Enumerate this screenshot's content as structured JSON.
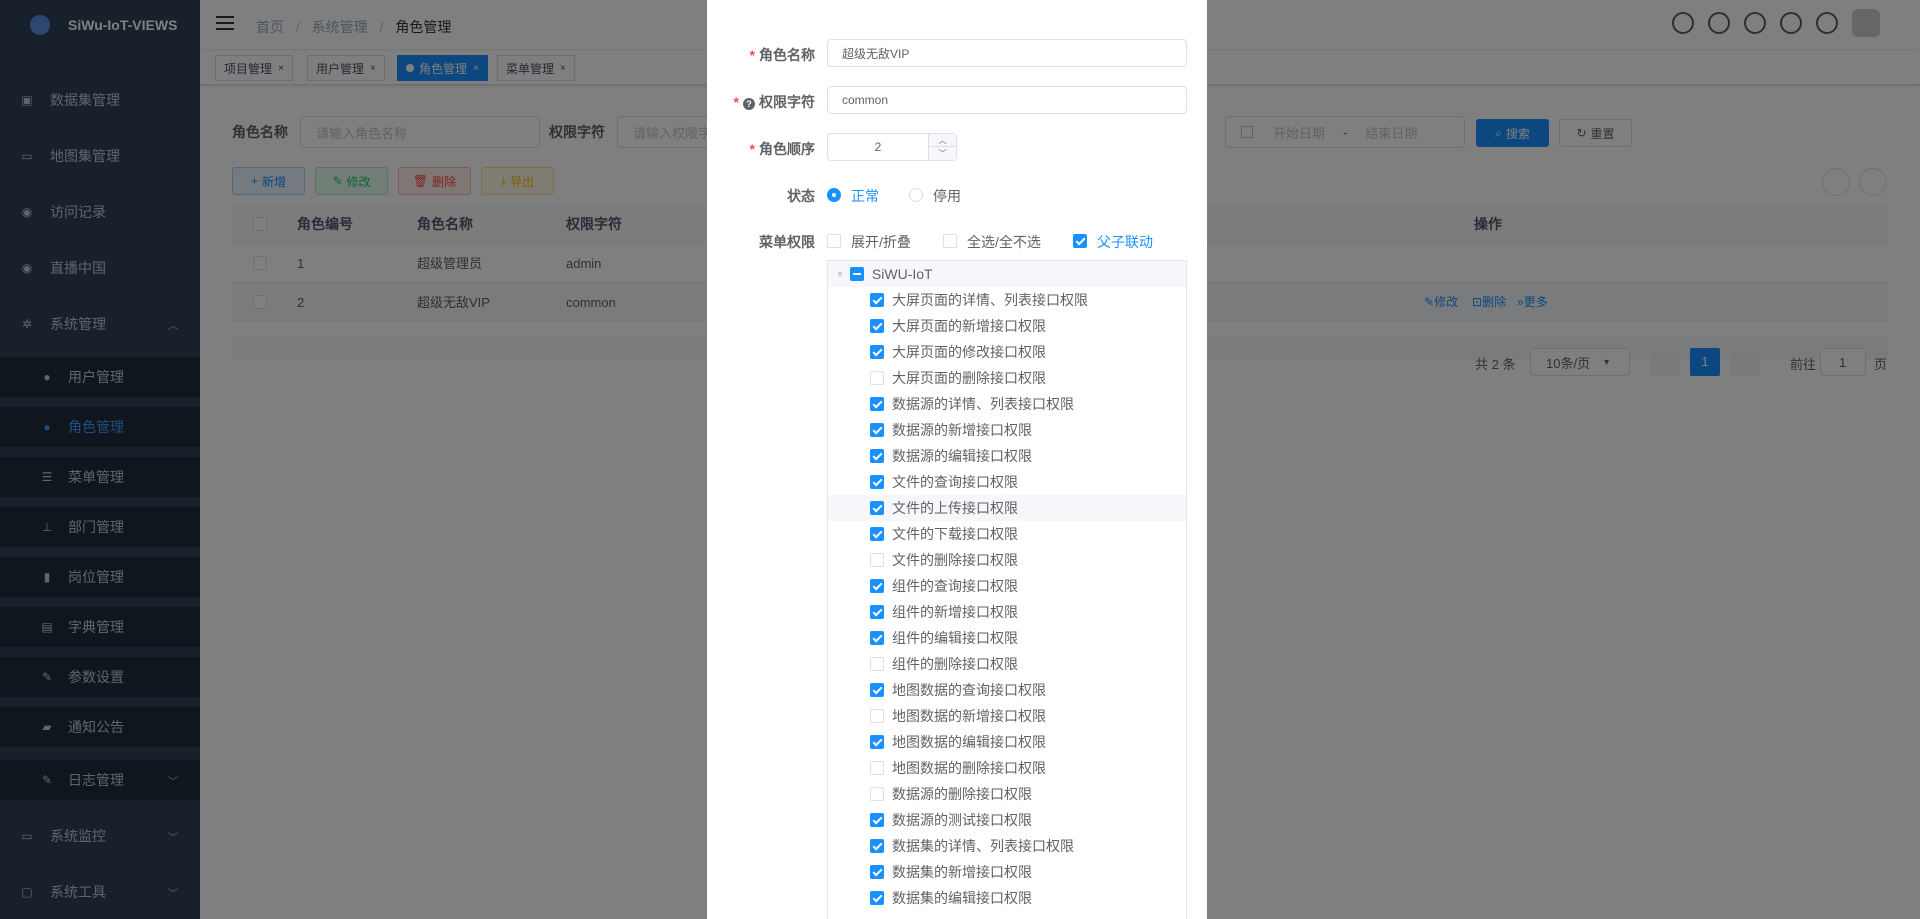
{
  "app": {
    "title": "SiWu-IoT-VIEWS"
  },
  "sidebar": {
    "items": [
      {
        "label": "数据集管理",
        "icon": "cart-icon"
      },
      {
        "label": "地图集管理",
        "icon": "monitor-icon"
      },
      {
        "label": "访问记录",
        "icon": "globe-icon"
      },
      {
        "label": "直播中国",
        "icon": "globe-icon"
      },
      {
        "label": "系统管理",
        "icon": "gear-icon"
      },
      {
        "label": "用户管理",
        "icon": "user-icon"
      },
      {
        "label": "角色管理",
        "icon": "peoples-icon"
      },
      {
        "label": "菜单管理",
        "icon": "tree-table-icon"
      },
      {
        "label": "部门管理",
        "icon": "tree-icon"
      },
      {
        "label": "岗位管理",
        "icon": "post-icon"
      },
      {
        "label": "字典管理",
        "icon": "dict-icon"
      },
      {
        "label": "参数设置",
        "icon": "edit-icon"
      },
      {
        "label": "通知公告",
        "icon": "message-icon"
      },
      {
        "label": "日志管理",
        "icon": "log-icon"
      },
      {
        "label": "系统监控",
        "icon": "monitor-icon"
      },
      {
        "label": "系统工具",
        "icon": "tool-icon"
      }
    ]
  },
  "breadcrumb": {
    "home": "首页",
    "sep": "/",
    "level1": "系统管理",
    "level2": "角色管理"
  },
  "tags": [
    "项目管理",
    "用户管理",
    "角色管理",
    "菜单管理"
  ],
  "search": {
    "role_name_label": "角色名称",
    "role_name_placeholder": "请输入角色名称",
    "role_key_label": "权限字符",
    "role_key_placeholder": "请输入权限字符",
    "date_start": "开始日期",
    "date_sep": "-",
    "date_end": "结束日期",
    "search_btn": "搜索",
    "reset_btn": "重置"
  },
  "toolbar": {
    "add": "新增",
    "edit": "修改",
    "delete": "删除",
    "export": "导出"
  },
  "table": {
    "headers": {
      "id": "角色编号",
      "name": "角色名称",
      "key": "权限字符",
      "ops": "操作"
    },
    "rows": [
      {
        "id": "1",
        "name": "超级管理员",
        "key": "admin"
      },
      {
        "id": "2",
        "name": "超级无敌VIP",
        "key": "common"
      }
    ],
    "row_ops": {
      "edit": "修改",
      "delete": "删除",
      "more": "更多"
    }
  },
  "pagination": {
    "total": "共 2 条",
    "page_size": "10条/页",
    "current": "1",
    "goto": "前往",
    "goto_val": "1",
    "page_unit": "页"
  },
  "dialog": {
    "role_name_label": "角色名称",
    "role_name_value": "超级无敌VIP",
    "role_key_label": "权限字符",
    "role_key_value": "common",
    "role_sort_label": "角色顺序",
    "role_sort_value": "2",
    "status_label": "状态",
    "status_normal": "正常",
    "status_disabled": "停用",
    "menu_label": "菜单权限",
    "expand": "展开/折叠",
    "select_all": "全选/全不选",
    "linkage": "父子联动",
    "tree_root": "SiWU-IoT",
    "tree_items": [
      {
        "label": "大屏页面的详情、列表接口权限",
        "checked": true
      },
      {
        "label": "大屏页面的新增接口权限",
        "checked": true
      },
      {
        "label": "大屏页面的修改接口权限",
        "checked": true
      },
      {
        "label": "大屏页面的删除接口权限",
        "checked": false
      },
      {
        "label": "数据源的详情、列表接口权限",
        "checked": true
      },
      {
        "label": "数据源的新增接口权限",
        "checked": true
      },
      {
        "label": "数据源的编辑接口权限",
        "checked": true
      },
      {
        "label": "文件的查询接口权限",
        "checked": true
      },
      {
        "label": "文件的上传接口权限",
        "checked": true
      },
      {
        "label": "文件的下载接口权限",
        "checked": true
      },
      {
        "label": "文件的删除接口权限",
        "checked": false
      },
      {
        "label": "组件的查询接口权限",
        "checked": true
      },
      {
        "label": "组件的新增接口权限",
        "checked": true
      },
      {
        "label": "组件的编辑接口权限",
        "checked": true
      },
      {
        "label": "组件的删除接口权限",
        "checked": false
      },
      {
        "label": "地图数据的查询接口权限",
        "checked": true
      },
      {
        "label": "地图数据的新增接口权限",
        "checked": false
      },
      {
        "label": "地图数据的编辑接口权限",
        "checked": true
      },
      {
        "label": "地图数据的删除接口权限",
        "checked": false
      },
      {
        "label": "数据源的删除接口权限",
        "checked": false
      },
      {
        "label": "数据源的测试接口权限",
        "checked": true
      },
      {
        "label": "数据集的详情、列表接口权限",
        "checked": true
      },
      {
        "label": "数据集的新增接口权限",
        "checked": true
      },
      {
        "label": "数据集的编辑接口权限",
        "checked": true
      }
    ]
  },
  "colors": {
    "primary": "#1890ff",
    "sidebar": "#304156",
    "danger": "#ff4949"
  }
}
